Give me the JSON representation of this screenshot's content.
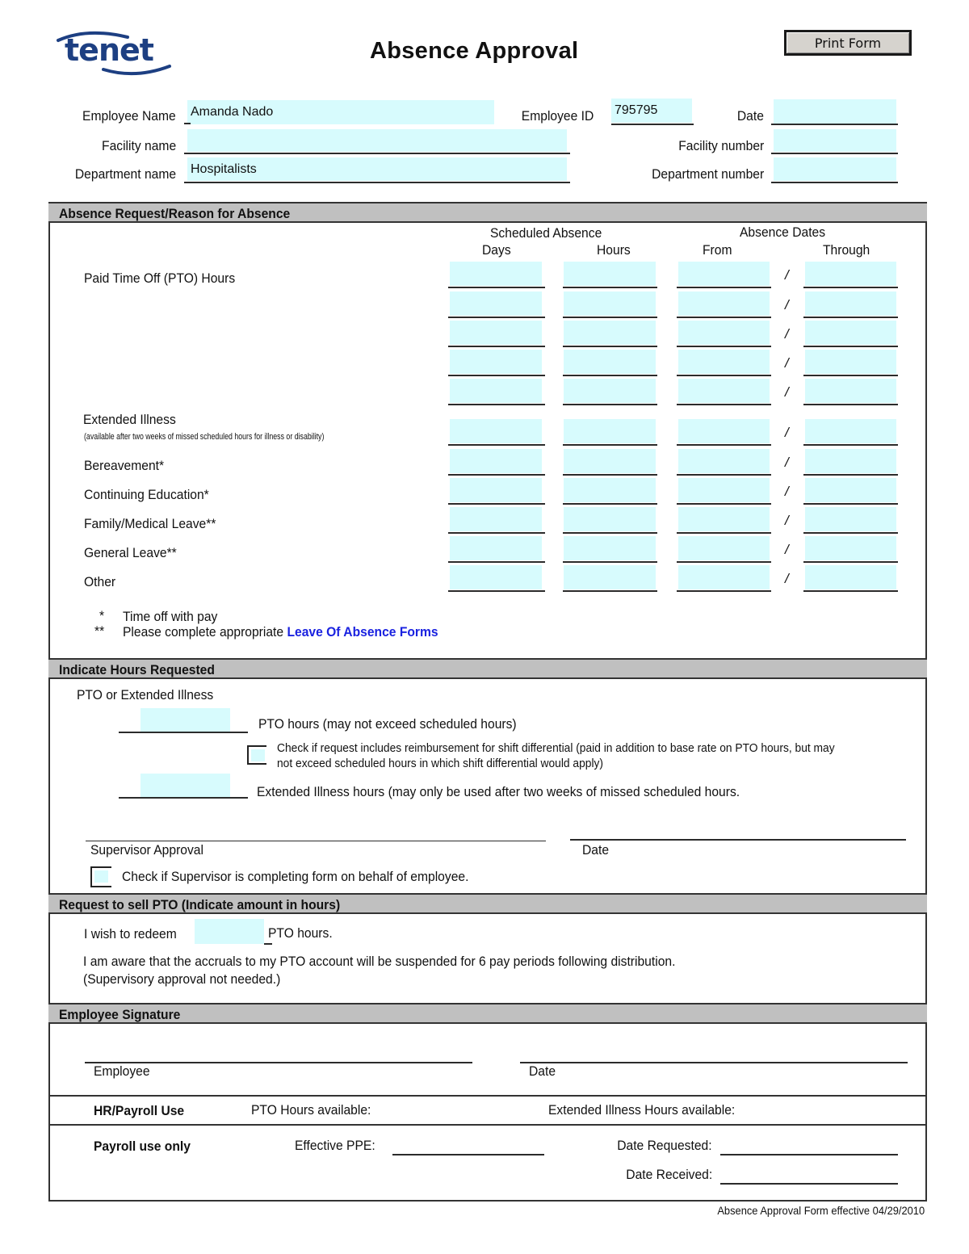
{
  "header": {
    "logo_text": "Tenet",
    "title": "Absence Approval",
    "print_button": "Print Form"
  },
  "employee_info": {
    "employee_name_label": "Employee Name",
    "employee_name_value": "Amanda Nado",
    "employee_id_label": "Employee ID",
    "employee_id_value": "795795",
    "date_label": "Date",
    "date_value": "",
    "facility_name_label": "Facility name",
    "facility_name_value": "",
    "facility_number_label": "Facility number",
    "facility_number_value": "",
    "department_name_label": "Department name",
    "department_name_value": "Hospitalists",
    "department_number_label": "Department number",
    "department_number_value": ""
  },
  "absence_section": {
    "title": "Absence Request/Reason for Absence",
    "col_group_scheduled": "Scheduled Absence",
    "col_group_dates": "Absence Dates",
    "col_days": "Days",
    "col_hours": "Hours",
    "col_from": "From",
    "col_through": "Through",
    "separator": "/",
    "rows": [
      {
        "label": "Paid Time Off (PTO)  Hours",
        "days": "",
        "hours": "",
        "from": "",
        "through": ""
      },
      {
        "label": "",
        "days": "",
        "hours": "",
        "from": "",
        "through": ""
      },
      {
        "label": "",
        "days": "",
        "hours": "",
        "from": "",
        "through": ""
      },
      {
        "label": "",
        "days": "",
        "hours": "",
        "from": "",
        "through": ""
      },
      {
        "label": "",
        "days": "",
        "hours": "",
        "from": "",
        "through": ""
      },
      {
        "label": "Extended Illness",
        "note": "(available after two weeks of missed scheduled hours for illness or disability)",
        "days": "",
        "hours": "",
        "from": "",
        "through": ""
      },
      {
        "label": "Bereavement*",
        "days": "",
        "hours": "",
        "from": "",
        "through": ""
      },
      {
        "label": "Continuing Education*",
        "days": "",
        "hours": "",
        "from": "",
        "through": ""
      },
      {
        "label": "Family/Medical Leave**",
        "days": "",
        "hours": "",
        "from": "",
        "through": ""
      },
      {
        "label": "General Leave**",
        "days": "",
        "hours": "",
        "from": "",
        "through": ""
      },
      {
        "label": "Other",
        "days": "",
        "hours": "",
        "from": "",
        "through": ""
      }
    ],
    "footnote1_mark": "*",
    "footnote1_text": "Time off with pay",
    "footnote2_mark": "**",
    "footnote2_text": "Please complete appropriate ",
    "footnote2_link": "Leave Of Absence Forms"
  },
  "hours_section": {
    "title": "Indicate Hours Requested",
    "subtitle": "PTO or Extended Illness",
    "pto_hours_value": "",
    "pto_hours_label": "PTO hours (may not exceed scheduled hours)",
    "shift_diff_checked": false,
    "shift_diff_line1": "Check if request includes reimbursement for shift differential (paid in addition to base rate on PTO hours, but  may",
    "shift_diff_line2": "not exceed scheduled hours in which shift differential would apply)",
    "ext_illness_value": "",
    "ext_illness_label": "Extended Illness hours (may only be used after two weeks of missed scheduled hours.",
    "supervisor_approval_label": "Supervisor Approval",
    "supervisor_date_label": "Date",
    "supervisor_behalf_checked": false,
    "supervisor_behalf_label": "Check if Supervisor is completing form on behalf of employee."
  },
  "sell_section": {
    "title": "Request to sell PTO (Indicate amount in hours)",
    "redeem_prefix": "I wish to redeem",
    "redeem_value": "",
    "redeem_suffix": "PTO hours.",
    "notice_line1": "I am aware that the accruals to my PTO account will be suspended for 6 pay periods following distribution.",
    "notice_line2": "(Supervisory approval not needed.)"
  },
  "signature_section": {
    "title": "Employee Signature",
    "employee_label": "Employee",
    "date_label": "Date"
  },
  "hr_section": {
    "hr_label": "HR/Payroll Use",
    "pto_available_label": "PTO Hours available:",
    "ext_available_label": "Extended Illness Hours available:",
    "payroll_label": "Payroll use only",
    "effective_ppe_label": "Effective PPE:",
    "date_requested_label": "Date Requested:",
    "date_received_label": "Date Received:"
  },
  "footer": {
    "text": "Absence Approval Form  effective 04/29/2010"
  },
  "colors": {
    "field_fill": "#d7fbfd",
    "section_bar": "#c0c0c0",
    "link": "#1a22e0",
    "logo": "#1d3f82"
  }
}
